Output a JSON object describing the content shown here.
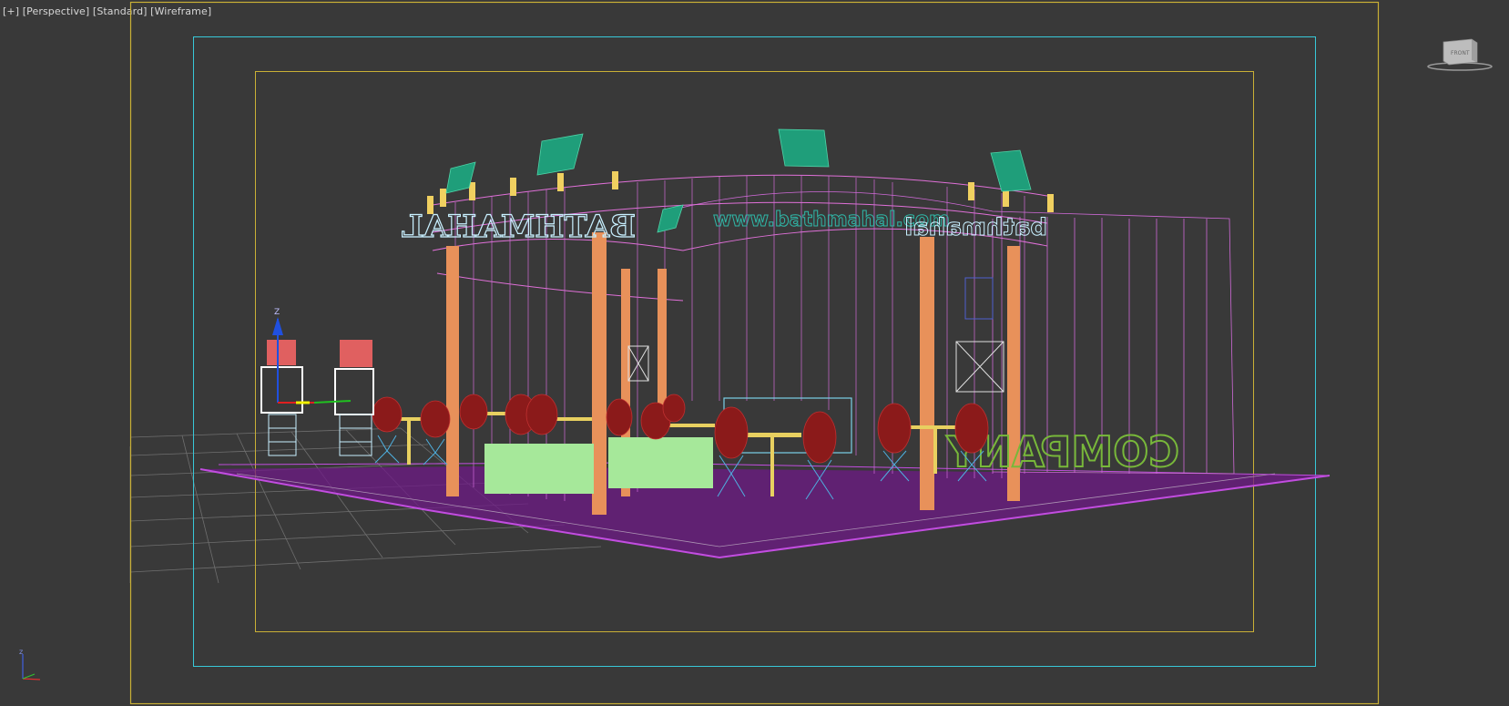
{
  "viewport": {
    "label_plus": "[+]",
    "label_view": "[Perspective]",
    "label_shading_style": "[Standard]",
    "label_render_mode": "[Wireframe]",
    "viewcube_face": "FRONT",
    "viewcube_icon": "viewcube-icon",
    "tripod_icon": "axis-tripod-icon",
    "gizmo_axis_label": "Z"
  },
  "scene": {
    "booth_sign_main": "BATHMAHAL",
    "booth_url": "www.bathmahal.com",
    "booth_sign_right": "bathmahal",
    "wall_text": "COMPANY"
  },
  "colors": {
    "viewport_bg": "#393939",
    "safe_frame_outer": "#c9b036",
    "safe_frame_action": "#38c8d8",
    "safe_frame_title": "#c9b036",
    "booth_wire": "#d06ad8",
    "floor": "#8a1fa8",
    "columns": "#e8915a",
    "chairs": "#8b1a1a",
    "lights": "#1f9e7a",
    "sofa": "#a6e89a",
    "grid": "#777777"
  }
}
